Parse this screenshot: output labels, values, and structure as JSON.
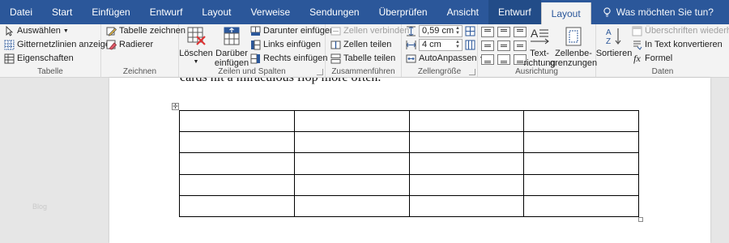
{
  "tabs": [
    "Datei",
    "Start",
    "Einfügen",
    "Entwurf",
    "Layout",
    "Verweise",
    "Sendungen",
    "Überprüfen",
    "Ansicht"
  ],
  "context_tabs": [
    "Entwurf",
    "Layout"
  ],
  "active_tab": "Layout",
  "tell_me": "Was möchten Sie tun?",
  "groups": {
    "tabelle": {
      "label": "Tabelle",
      "select": "Auswählen",
      "gridlines": "Gitternetzlinien anzeigen",
      "properties": "Eigenschaften"
    },
    "zeichnen": {
      "label": "Zeichnen",
      "draw": "Tabelle zeichnen",
      "eraser": "Radierer"
    },
    "zeilen": {
      "label": "Zeilen und Spalten",
      "delete": "Löschen",
      "insert_above_1": "Darüber",
      "insert_above_2": "einfügen",
      "insert_below": "Darunter einfügen",
      "insert_left": "Links einfügen",
      "insert_right": "Rechts einfügen"
    },
    "zusammen": {
      "label": "Zusammenführen",
      "merge": "Zellen verbinden",
      "split": "Zellen teilen",
      "split_table": "Tabelle teilen"
    },
    "zellgroesse": {
      "label": "Zellengröße",
      "height_value": "0,59 cm",
      "width_value": "4 cm",
      "autofit": "AutoAnpassen"
    },
    "ausrichtung": {
      "label": "Ausrichtung",
      "direction_1": "Text-",
      "direction_2": "richtung",
      "margins_1": "Zellenbe-",
      "margins_2": "grenzungen"
    },
    "daten": {
      "label": "Daten",
      "sort": "Sortieren",
      "repeat_header": "Überschriften wiederholen",
      "convert": "In Text konvertieren",
      "formula": "Formel"
    }
  },
  "document": {
    "cut_text": "cards hit a miraculous flop more often.",
    "margin_note": "Blog",
    "table": {
      "rows": 5,
      "cols": 4
    }
  },
  "colors": {
    "ribbon_blue": "#2b579a",
    "context_blue": "#224c88",
    "ribbon_bg": "#f3f3f3"
  }
}
